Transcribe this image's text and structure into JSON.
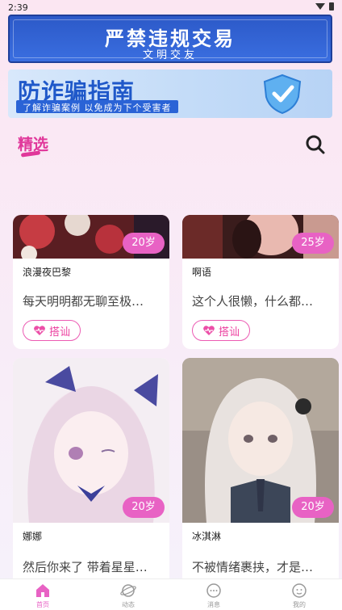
{
  "status_bar": {
    "time": "2:39"
  },
  "banner_notice": {
    "title": "严禁违规交易",
    "subtitle": "文明交友"
  },
  "banner_fraud": {
    "title": "防诈骗指南",
    "subtitle": "了解诈骗案例 以免成为下个受害者"
  },
  "section": {
    "tab_label": "精选"
  },
  "cards": [
    {
      "name": "浪漫夜巴黎",
      "age": "20岁",
      "bio": "每天明明都无聊至极…",
      "chat_label": "搭讪"
    },
    {
      "name": "啊语",
      "age": "25岁",
      "bio": "这个人很懒，什么都…",
      "chat_label": "搭讪"
    },
    {
      "name": "娜娜",
      "age": "20岁",
      "bio": "然后你来了 带着星星…"
    },
    {
      "name": "冰淇淋",
      "age": "20岁",
      "bio": "不被情绪裹挟，才是…"
    }
  ],
  "tab_bar": {
    "items": [
      {
        "label": "首页",
        "icon": "home-icon",
        "active": true
      },
      {
        "label": "动态",
        "icon": "planet-icon",
        "active": false
      },
      {
        "label": "消息",
        "icon": "message-icon",
        "active": false
      },
      {
        "label": "我的",
        "icon": "profile-icon",
        "active": false
      }
    ]
  },
  "colors": {
    "accent": "#e862c4",
    "brand_blue": "#2c59c8"
  }
}
